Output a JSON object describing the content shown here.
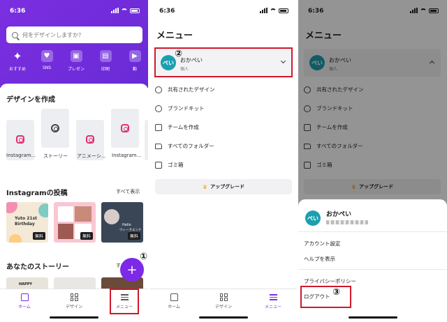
{
  "status": {
    "time": "6:36"
  },
  "home": {
    "search_placeholder": "何をデザインしますか？",
    "categories": [
      {
        "label": "おすすめ",
        "icon": "sparkle-icon"
      },
      {
        "label": "SNS",
        "icon": "heart-chat-icon"
      },
      {
        "label": "プレゼン",
        "icon": "presentation-icon"
      },
      {
        "label": "印刷",
        "icon": "print-icon"
      },
      {
        "label": "動",
        "icon": "video-icon"
      }
    ],
    "create_title": "デザインを作成",
    "templates": [
      "Instagram...",
      "ストーリー",
      "アニメーシ...",
      "Instagram..."
    ],
    "posts_title": "Instagramの投稿",
    "see_all": "すべて表示",
    "post_cards": [
      {
        "line1": "Yuto 21st",
        "line2": "Birthday",
        "badge": "無料"
      },
      {
        "line1": "",
        "line2": "",
        "badge": "無料"
      },
      {
        "line1": "Hello",
        "line2": "ウィークエンド",
        "badge": "無料"
      }
    ],
    "stories_title": "あなたのストーリー",
    "stories_see_all": "す",
    "story_card_text": "HAPPY",
    "fab_label": "+"
  },
  "nav": {
    "home": "ホーム",
    "design": "デザイン",
    "menu": "メニュー"
  },
  "menu": {
    "title": "メニュー",
    "account_name": "おかぺい",
    "account_type": "個人",
    "avatar_text": "ぺい",
    "items": [
      "共有されたデザイン",
      "ブランドキット",
      "チームを作成",
      "すべてのフォルダー",
      "ゴミ箱"
    ],
    "upgrade": "アップグレード"
  },
  "sheet": {
    "name": "おかぺい",
    "items": [
      "アカウント設定",
      "ヘルプを表示",
      "プライバシーポリシー",
      "ログアウト"
    ]
  },
  "annotations": {
    "step1": "①",
    "step2": "②",
    "step3": "③"
  },
  "colors": {
    "brand_purple": "#7d2ae8",
    "avatar_teal": "#1c9fb0",
    "highlight_red": "#d0182a"
  }
}
